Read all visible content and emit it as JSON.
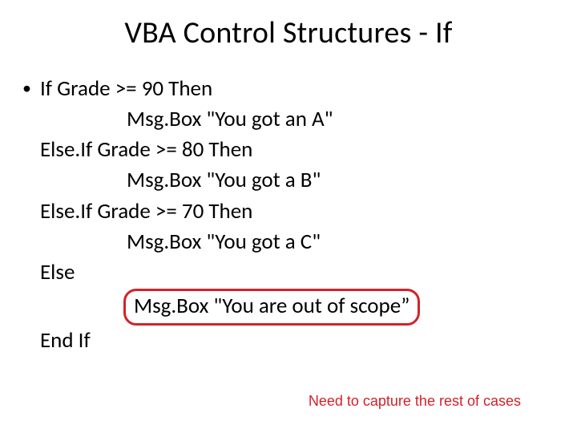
{
  "title": "VBA Control Structures - If",
  "bullet": "•",
  "code": {
    "line1": "If  Grade >= 90 Then",
    "line2": "Msg.Box \"You got an A\"",
    "line3": "Else.If Grade >= 80 Then",
    "line4": "Msg.Box \"You got a B\"",
    "line5": "Else.If Grade >= 70 Then",
    "line6": "Msg.Box \"You got a C\"",
    "line7": "Else",
    "line8": "Msg.Box \"You are out of scope”",
    "line9": "End If"
  },
  "annotation": "Need to capture the rest of cases"
}
